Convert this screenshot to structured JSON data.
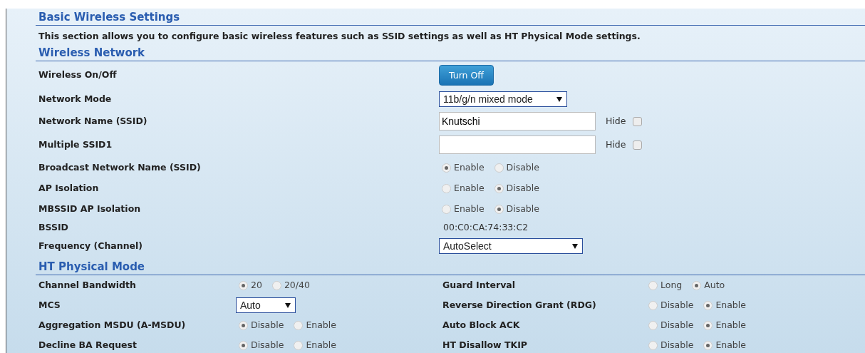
{
  "title": "Basic Wireless Settings",
  "description": "This section allows you to configure basic wireless features such as SSID settings as well as HT Physical Mode settings.",
  "wireless": {
    "title": "Wireless Network",
    "rows": [
      {
        "label": "Wireless On/Off",
        "control": {
          "kind": "button",
          "label": "Turn Off"
        }
      },
      {
        "label": "Network Mode",
        "control": {
          "kind": "select",
          "value": "11b/g/n mixed mode"
        }
      },
      {
        "label": "Network Name (SSID)",
        "control": {
          "kind": "text",
          "value": "Knutschi",
          "hide_label": "Hide",
          "hide_checked": false
        }
      },
      {
        "label": "Multiple SSID1",
        "control": {
          "kind": "text",
          "hide_label": "Hide",
          "hide_checked": false
        }
      },
      {
        "label": "Broadcast Network Name (SSID)",
        "control": {
          "kind": "radio",
          "options": [
            {
              "label": "Enable",
              "selected": true
            },
            {
              "label": "Disable",
              "selected": false
            }
          ]
        }
      },
      {
        "label": "AP Isolation",
        "control": {
          "kind": "radio",
          "options": [
            {
              "label": "Enable",
              "selected": false
            },
            {
              "label": "Disable",
              "selected": true
            }
          ]
        }
      },
      {
        "label": "MBSSID AP Isolation",
        "control": {
          "kind": "radio",
          "options": [
            {
              "label": "Enable",
              "selected": false
            },
            {
              "label": "Disable",
              "selected": true
            }
          ]
        }
      },
      {
        "label": "BSSID",
        "control": {
          "kind": "static",
          "value": "00:C0:CA:74:33:C2"
        }
      },
      {
        "label": "Frequency (Channel)",
        "control": {
          "kind": "select",
          "value": "AutoSelect"
        }
      }
    ]
  },
  "ht": {
    "title": "HT Physical Mode",
    "rows": [
      {
        "left": {
          "label": "Channel Bandwidth",
          "control": {
            "kind": "radio",
            "options": [
              {
                "label": "20",
                "selected": true
              },
              {
                "label": "20/40",
                "selected": false
              }
            ]
          }
        },
        "right": {
          "label": "Guard Interval",
          "control": {
            "kind": "radio",
            "options": [
              {
                "label": "Long",
                "selected": false
              },
              {
                "label": "Auto",
                "selected": true
              }
            ]
          }
        }
      },
      {
        "left": {
          "label": "MCS",
          "control": {
            "kind": "select",
            "value": "Auto"
          }
        },
        "right": {
          "label": "Reverse Direction Grant (RDG)",
          "control": {
            "kind": "radio",
            "options": [
              {
                "label": "Disable",
                "selected": false
              },
              {
                "label": "Enable",
                "selected": true
              }
            ]
          }
        }
      },
      {
        "left": {
          "label": "Aggregation MSDU (A-MSDU)",
          "control": {
            "kind": "radio",
            "options": [
              {
                "label": "Disable",
                "selected": true
              },
              {
                "label": "Enable",
                "selected": false
              }
            ]
          }
        },
        "right": {
          "label": "Auto Block ACK",
          "control": {
            "kind": "radio",
            "options": [
              {
                "label": "Disable",
                "selected": false
              },
              {
                "label": "Enable",
                "selected": true
              }
            ]
          }
        }
      },
      {
        "left": {
          "label": "Decline BA Request",
          "control": {
            "kind": "radio",
            "options": [
              {
                "label": "Disable",
                "selected": true
              },
              {
                "label": "Enable",
                "selected": false
              }
            ]
          }
        },
        "right": {
          "label": "HT Disallow TKIP",
          "control": {
            "kind": "radio",
            "options": [
              {
                "label": "Disable",
                "selected": false
              },
              {
                "label": "Enable",
                "selected": true
              }
            ]
          }
        }
      }
    ]
  }
}
